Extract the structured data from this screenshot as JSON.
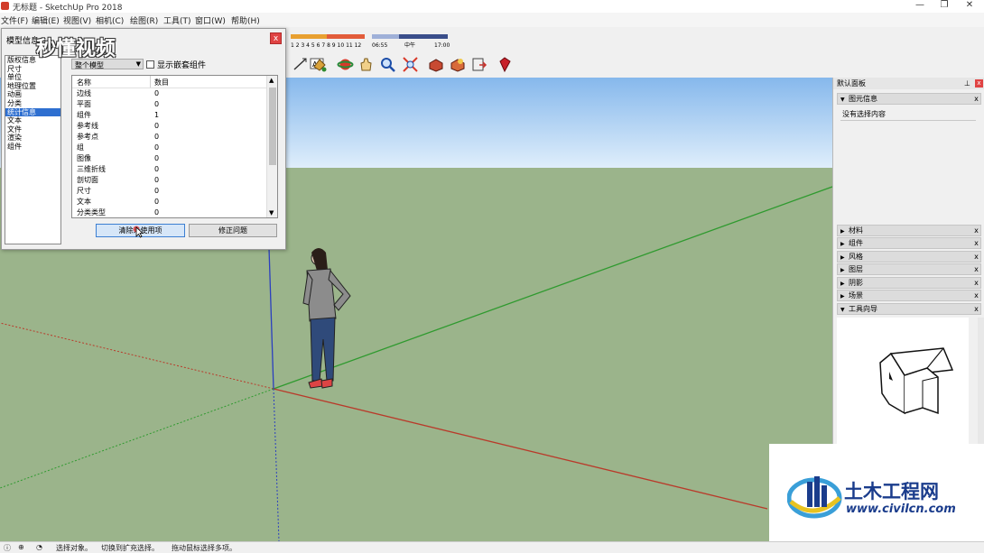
{
  "window": {
    "title": "无标题 - SketchUp Pro 2018",
    "controls": {
      "minimize": "—",
      "maximize": "❐",
      "close": "✕"
    }
  },
  "menu": [
    "文件(F)",
    "编辑(E)",
    "视图(V)",
    "相机(C)",
    "绘图(R)",
    "工具(T)",
    "窗口(W)",
    "帮助(H)"
  ],
  "toolbar": {
    "shadow_months": "1 2 3 4 5 6 7 8 9 10 11 12",
    "shadow_time_start": "06:55",
    "shadow_time_mid": "中午",
    "shadow_time_end": "17:00"
  },
  "dialog": {
    "title": "模型信息",
    "close_label": "x",
    "nav_items": [
      "版权信息",
      "尺寸",
      "单位",
      "地理位置",
      "动画",
      "分类",
      "统计信息",
      "文本",
      "文件",
      "渲染",
      "组件"
    ],
    "selected_nav": "统计信息",
    "dropdown_value": "整个模型",
    "checkbox_label": "显示嵌套组件",
    "table_headers": {
      "name": "名称",
      "count": "数目"
    },
    "rows": [
      {
        "name": "边线",
        "count": "0"
      },
      {
        "name": "平面",
        "count": "0"
      },
      {
        "name": "组件",
        "count": "1"
      },
      {
        "name": "参考线",
        "count": "0"
      },
      {
        "name": "参考点",
        "count": "0"
      },
      {
        "name": "组",
        "count": "0"
      },
      {
        "name": "图像",
        "count": "0"
      },
      {
        "name": "三维折线",
        "count": "0"
      },
      {
        "name": "剖切面",
        "count": "0"
      },
      {
        "name": "尺寸",
        "count": "0"
      },
      {
        "name": "文本",
        "count": "0"
      },
      {
        "name": "分类类型",
        "count": "0"
      }
    ],
    "purge_button": "清除未使用项",
    "fix_button": "修正问题"
  },
  "tray": {
    "title": "默认面板",
    "pin_label": "⊥",
    "entity_info": {
      "label": "图元信息",
      "content": "没有选择内容"
    },
    "panels": [
      "材料",
      "组件",
      "风格",
      "图层",
      "阴影",
      "场景"
    ],
    "instructor": {
      "label": "工具向导"
    },
    "close_label": "x"
  },
  "status_bar": {
    "text1": "选择对象。",
    "text2": "切换到扩充选择。",
    "text3": "拖动鼠标选择多项。"
  },
  "watermarks": {
    "video": "秒懂视频",
    "site_name": "土木工程网",
    "site_url": "www.civilcn.com"
  },
  "colors": {
    "sky_top": "#86b8ec",
    "sky_bottom": "#dfeefb",
    "ground": "#9bb48b",
    "axis_red": "#b93a2a",
    "axis_green": "#2f9a2f",
    "axis_blue": "#2b3fbf",
    "selection": "#2e6fd0"
  }
}
